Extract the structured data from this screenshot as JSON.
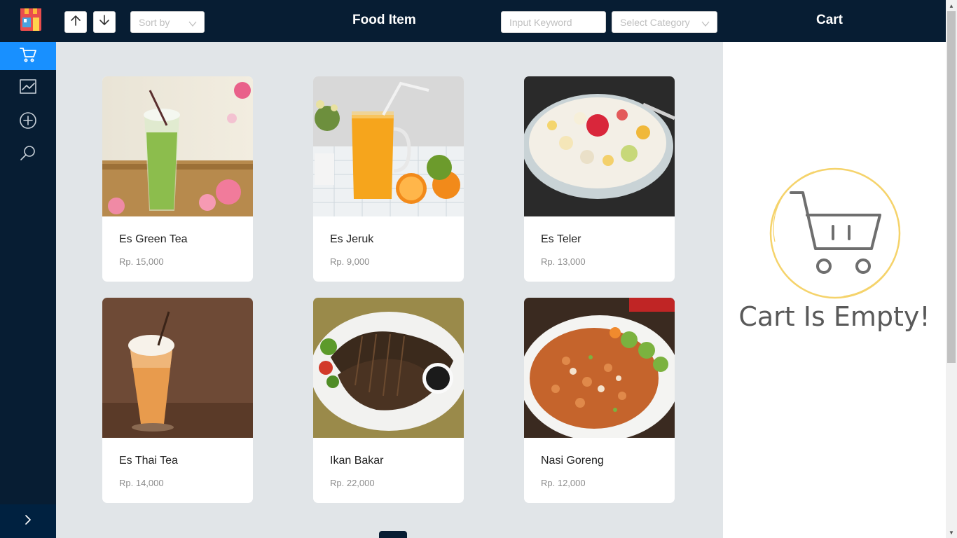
{
  "header": {
    "sort_placeholder": "Sort by",
    "title": "Food Item",
    "keyword_placeholder": "Input Keyword",
    "category_placeholder": "Select Category",
    "cart_title": "Cart"
  },
  "sidebar": {
    "items": [
      {
        "icon": "cart-icon",
        "active": true
      },
      {
        "icon": "chart-icon",
        "active": false
      },
      {
        "icon": "add-icon",
        "active": false
      },
      {
        "icon": "search-icon",
        "active": false
      }
    ]
  },
  "products": [
    {
      "name": "Es Green Tea",
      "price": "Rp. 15,000",
      "image": "green tea drink"
    },
    {
      "name": "Es Jeruk",
      "price": "Rp. 9,000",
      "image": "orange juice"
    },
    {
      "name": "Es Teler",
      "price": "Rp. 13,000",
      "image": "fruit dessert bowl"
    },
    {
      "name": "Es Thai Tea",
      "price": "Rp. 14,000",
      "image": "thai tea drink"
    },
    {
      "name": "Ikan Bakar",
      "price": "Rp. 22,000",
      "image": "grilled fish"
    },
    {
      "name": "Nasi Goreng",
      "price": "Rp. 12,000",
      "image": "fried rice"
    }
  ],
  "cart": {
    "empty_text": "Cart Is Empty!"
  },
  "colors": {
    "sidebar_bg": "#071d33",
    "active": "#1890ff",
    "cart_ring": "#f5d36b"
  }
}
